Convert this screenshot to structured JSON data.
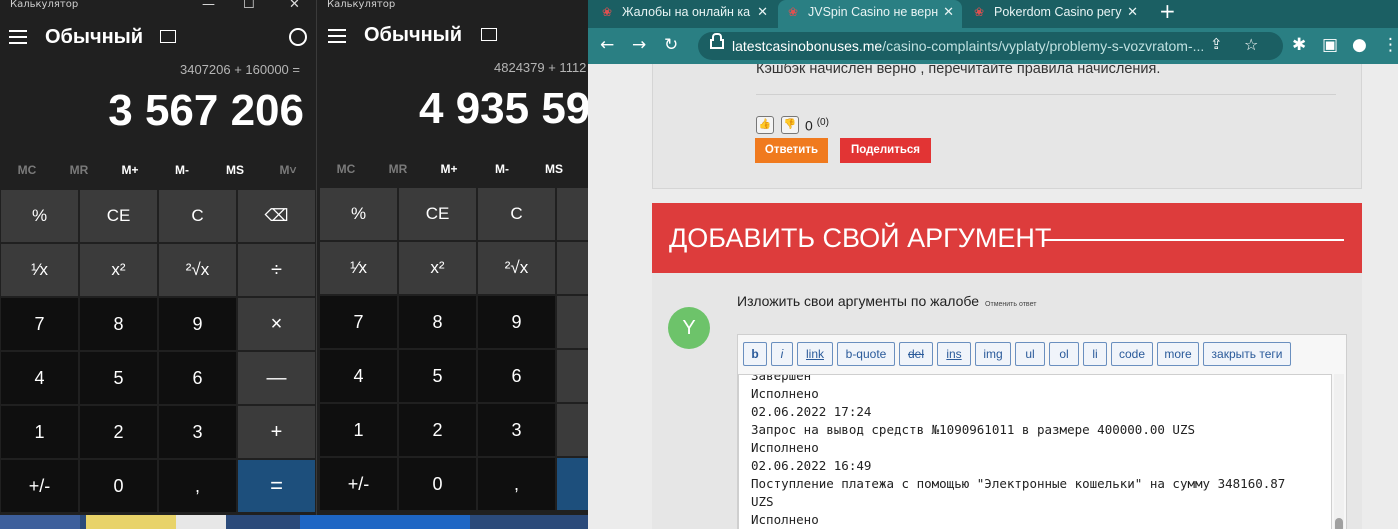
{
  "calc1": {
    "title": "Калькулятор",
    "mode": "Обычный",
    "expression": "3407206 + 160000 =",
    "display": "3 567 206",
    "memory": [
      "MC",
      "MR",
      "M+",
      "M-",
      "MS",
      "M˅"
    ],
    "keys": [
      "%",
      "CE",
      "C",
      "⌫",
      "¹⁄x",
      "x²",
      "²√x",
      "÷",
      "7",
      "8",
      "9",
      "×",
      "4",
      "5",
      "6",
      "—",
      "1",
      "2",
      "3",
      "+",
      "+/-",
      "0",
      ",",
      "="
    ]
  },
  "calc2": {
    "title": "Калькулятор",
    "mode": "Обычный",
    "expression": "4824379 + 1112",
    "display": "4 935 59",
    "memory": [
      "MC",
      "MR",
      "M+",
      "M-",
      "MS"
    ],
    "keys": [
      "%",
      "CE",
      "C",
      "",
      "¹⁄x",
      "x²",
      "²√x",
      "",
      "7",
      "8",
      "9",
      "",
      "4",
      "5",
      "6",
      "",
      "1",
      "2",
      "3",
      "",
      "+/-",
      "0",
      ",",
      ""
    ]
  },
  "browser": {
    "tabs": [
      {
        "label": "Жалобы на онлайн ка",
        "active": false
      },
      {
        "label": "JVSpin Casino не верн",
        "active": true
      },
      {
        "label": "Pokerdom Casino регу",
        "active": false
      }
    ],
    "url_domain": "latestcasinobonuses.me",
    "url_path": "/casino-complaints/vyplaty/problemy-s-vozvratom-...",
    "comment_text": "Кэшбэк начислен верно , перечитайте правила начисления.",
    "vote_count": "0",
    "vote_sup": "(0)",
    "reply_label": "Ответить",
    "share_label": "Поделиться",
    "add_argument_title": "ДОБАВИТЬ СВОЙ АРГУМЕНТ",
    "avatar_letter": "Y",
    "form_title": "Изложить свои аргументы по жалобе",
    "cancel_reply": "Отменить ответ",
    "quicktags": [
      "b",
      "i",
      "link",
      "b-quote",
      "del",
      "ins",
      "img",
      "ul",
      "ol",
      "li",
      "code",
      "more",
      "закрыть теги"
    ],
    "textarea_lines": [
      "Завершен",
      "Исполнено",
      "02.06.2022 17:24",
      "Запрос на вывод средств №1090961011 в размере 400000.00 UZS",
      "Исполнено",
      "02.06.2022 16:49",
      "Поступление платежа с помощью \"Электронные кошельки\" на сумму 348160.87",
      "UZS",
      "Исполнено"
    ]
  },
  "colors": {
    "browser_theme": "#2a7f83",
    "reply_button": "#f07a1e",
    "share_button": "#e23434",
    "add_argument_banner": "#dd3c3c",
    "avatar": "#6dc36a",
    "calc_equals": "#1d4f7c"
  }
}
